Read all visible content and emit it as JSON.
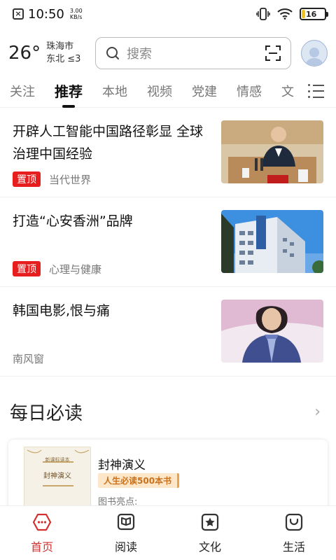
{
  "status_bar": {
    "time": "10:50",
    "speed_value": "3.00",
    "speed_unit": "KB/s",
    "battery": "16",
    "battery_level": 0.16
  },
  "header": {
    "temperature": "26°",
    "city": "珠海市",
    "wind": "东北  ≤3",
    "search_placeholder": "搜索"
  },
  "tabs": [
    {
      "label": "关注"
    },
    {
      "label": "推荐",
      "active": true
    },
    {
      "label": "本地"
    },
    {
      "label": "视频"
    },
    {
      "label": "党建"
    },
    {
      "label": "情感"
    },
    {
      "label": "文"
    }
  ],
  "articles": [
    {
      "title": "开辟人工智能中国路径彰显 全球 治理中国经验",
      "badge": "置顶",
      "source": "当代世界"
    },
    {
      "title": "打造“心安香洲”品牌",
      "badge": "置顶",
      "source": "心理与健康"
    },
    {
      "title": "韩国电影,恨与痛",
      "source": "南风窗"
    }
  ],
  "daily": {
    "title": "每日必读",
    "book": {
      "name": "封神演义",
      "tag": "人生必读500本书",
      "highlight": "图书亮点:",
      "cover_top": "新课标读本",
      "cover_title": "封神演义"
    }
  },
  "bottom_nav": [
    {
      "label": "首页",
      "icon": "home-icon",
      "active": true
    },
    {
      "label": "阅读",
      "icon": "book-icon"
    },
    {
      "label": "文化",
      "icon": "star-icon"
    },
    {
      "label": "生活",
      "icon": "smile-bag-icon"
    }
  ],
  "colors": {
    "accent_red": "#e61e1e",
    "nav_active": "#d33131",
    "battery_yellow": "#f0c419"
  }
}
